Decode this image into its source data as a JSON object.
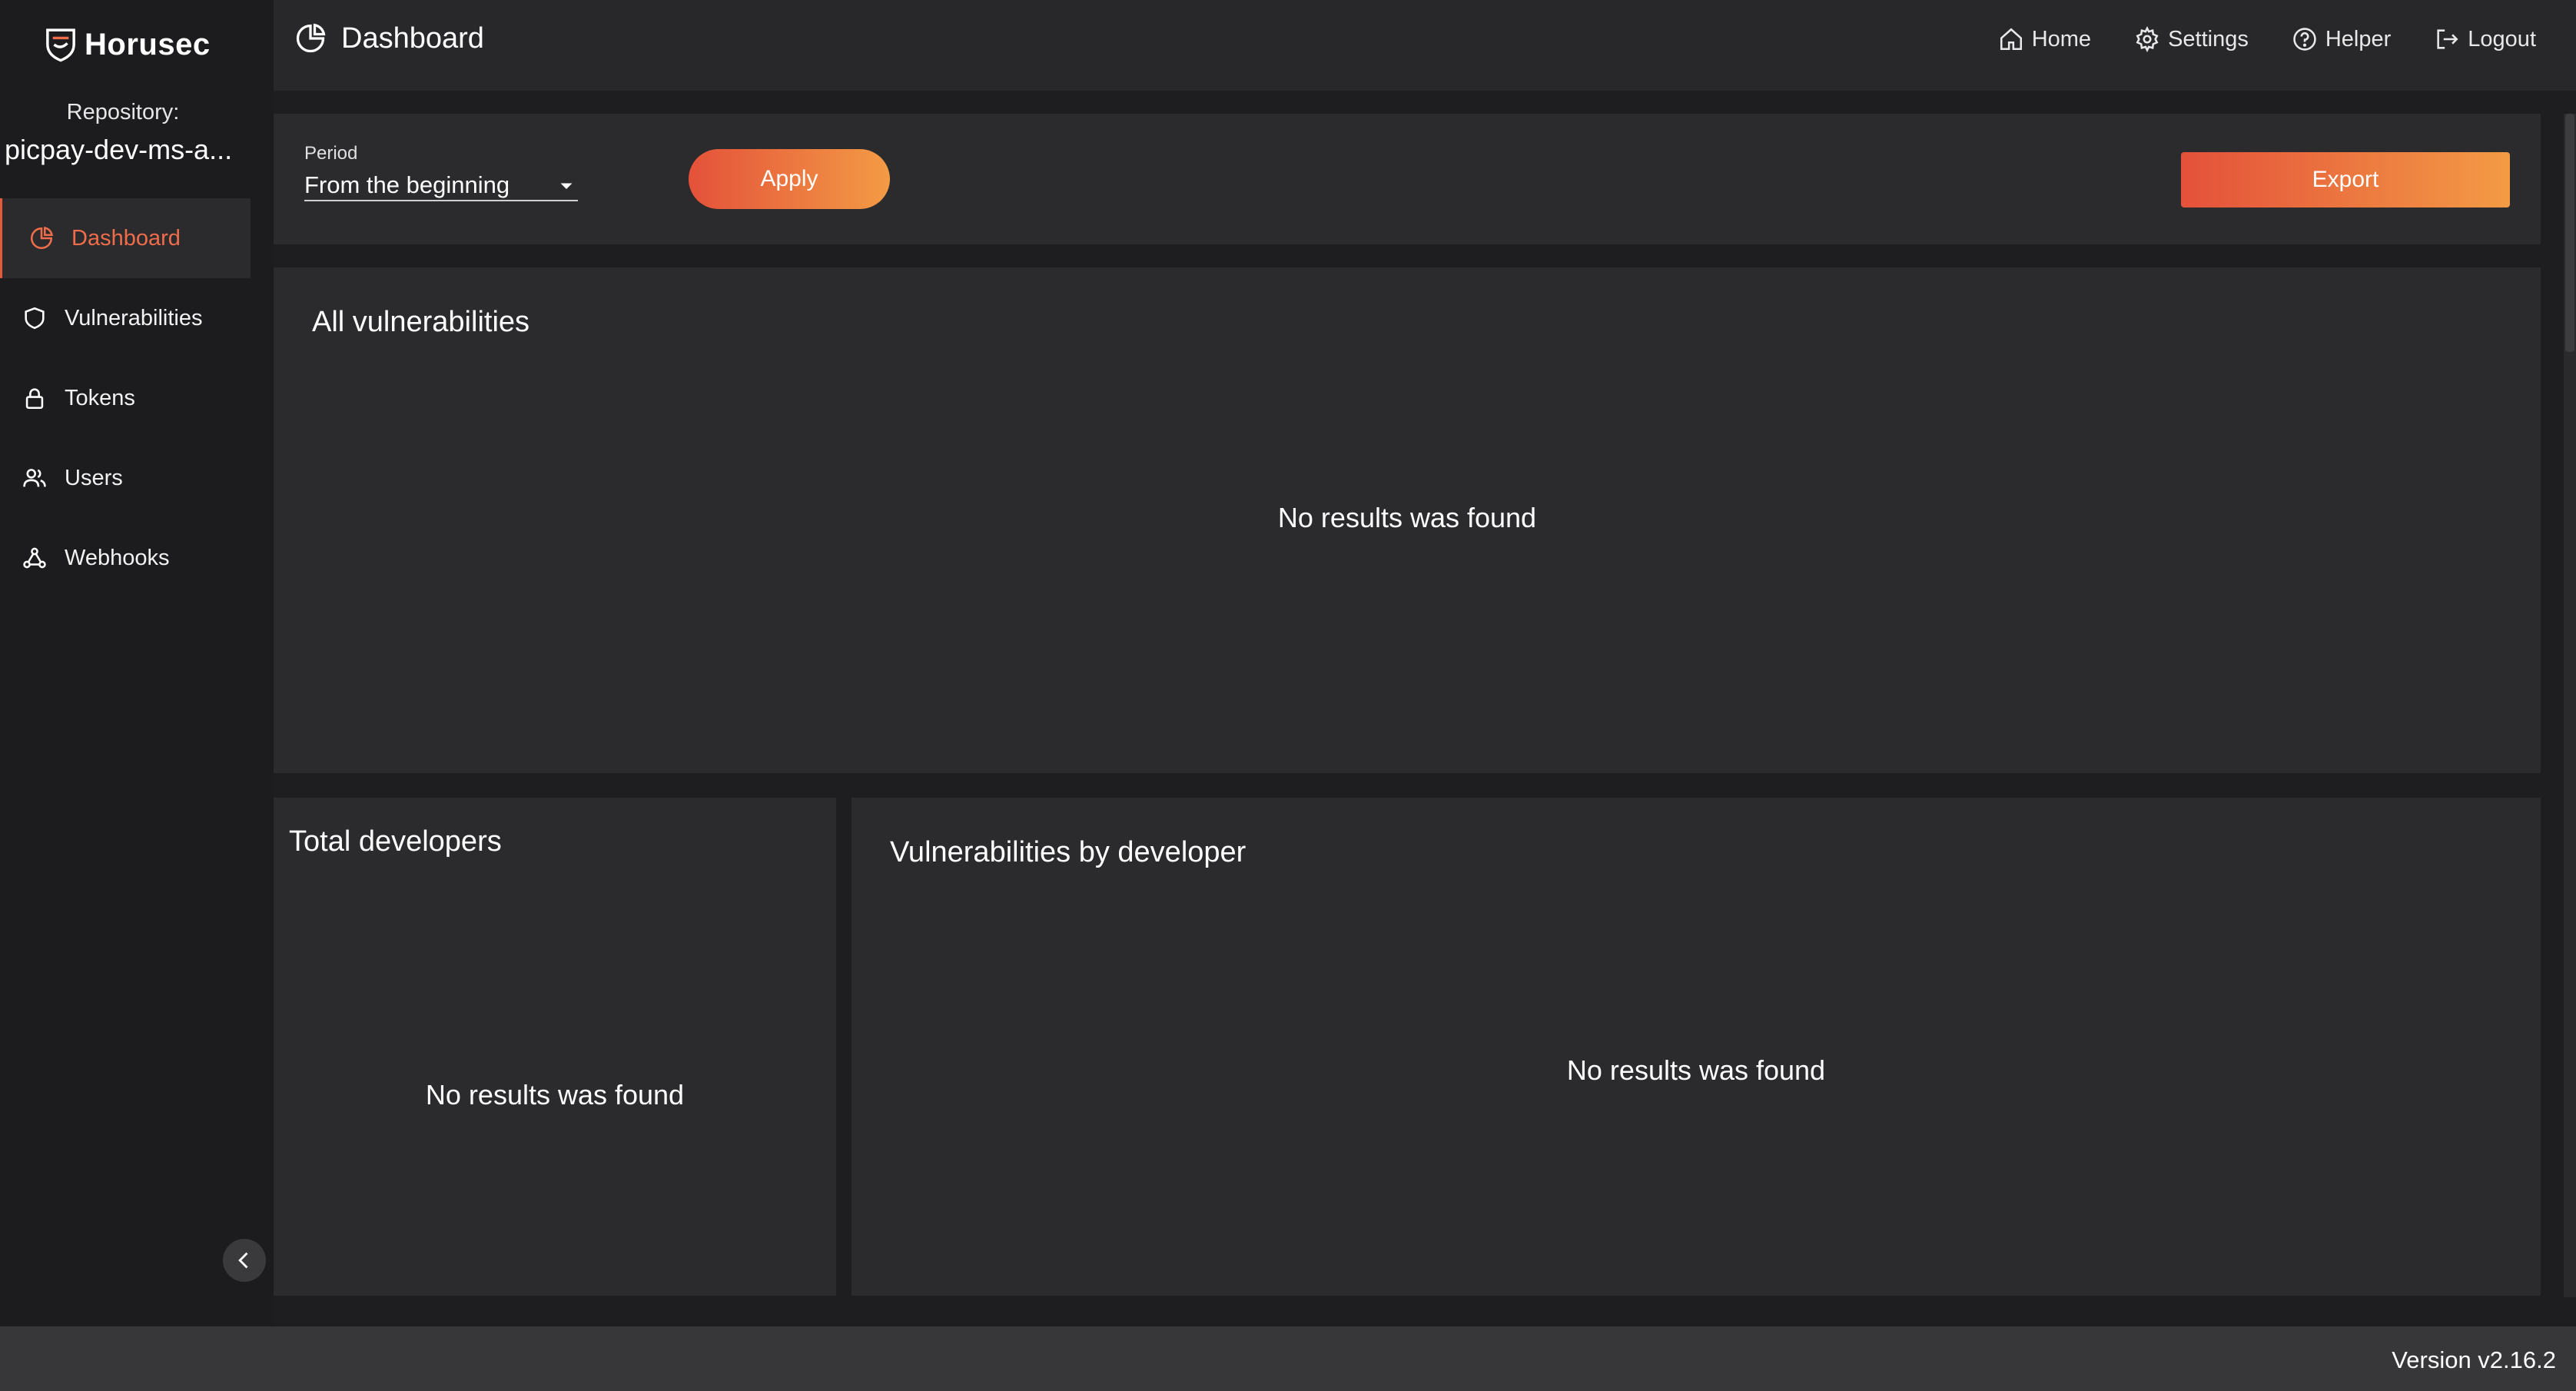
{
  "app": {
    "name": "Horusec"
  },
  "sidebar": {
    "repository_label": "Repository:",
    "repository_name": "picpay-dev-ms-a...",
    "items": [
      {
        "label": "Dashboard",
        "icon": "pie-chart-icon",
        "active": true
      },
      {
        "label": "Vulnerabilities",
        "icon": "shield-icon"
      },
      {
        "label": "Tokens",
        "icon": "lock-icon"
      },
      {
        "label": "Users",
        "icon": "users-icon"
      },
      {
        "label": "Webhooks",
        "icon": "webhook-icon"
      }
    ]
  },
  "header": {
    "title": "Dashboard",
    "nav": [
      {
        "label": "Home",
        "icon": "home-icon"
      },
      {
        "label": "Settings",
        "icon": "gear-icon"
      },
      {
        "label": "Helper",
        "icon": "help-circle-icon"
      },
      {
        "label": "Logout",
        "icon": "logout-icon"
      }
    ]
  },
  "filters": {
    "period_label": "Period",
    "period_value": "From the beginning",
    "apply_label": "Apply",
    "export_label": "Export"
  },
  "panels": {
    "all_vulnerabilities": {
      "title": "All vulnerabilities",
      "empty": "No results was found"
    },
    "total_developers": {
      "title": "Total developers",
      "empty": "No results was found"
    },
    "vulnerabilities_by_developer": {
      "title": "Vulnerabilities by developer",
      "empty": "No results was found"
    }
  },
  "footer": {
    "version": "Version v2.16.2"
  },
  "colors": {
    "accent": "#ef6d4a",
    "gradient_start": "#e4513a",
    "gradient_end": "#f39b45",
    "background": "#1e1e20",
    "panel": "#2b2b2d"
  }
}
